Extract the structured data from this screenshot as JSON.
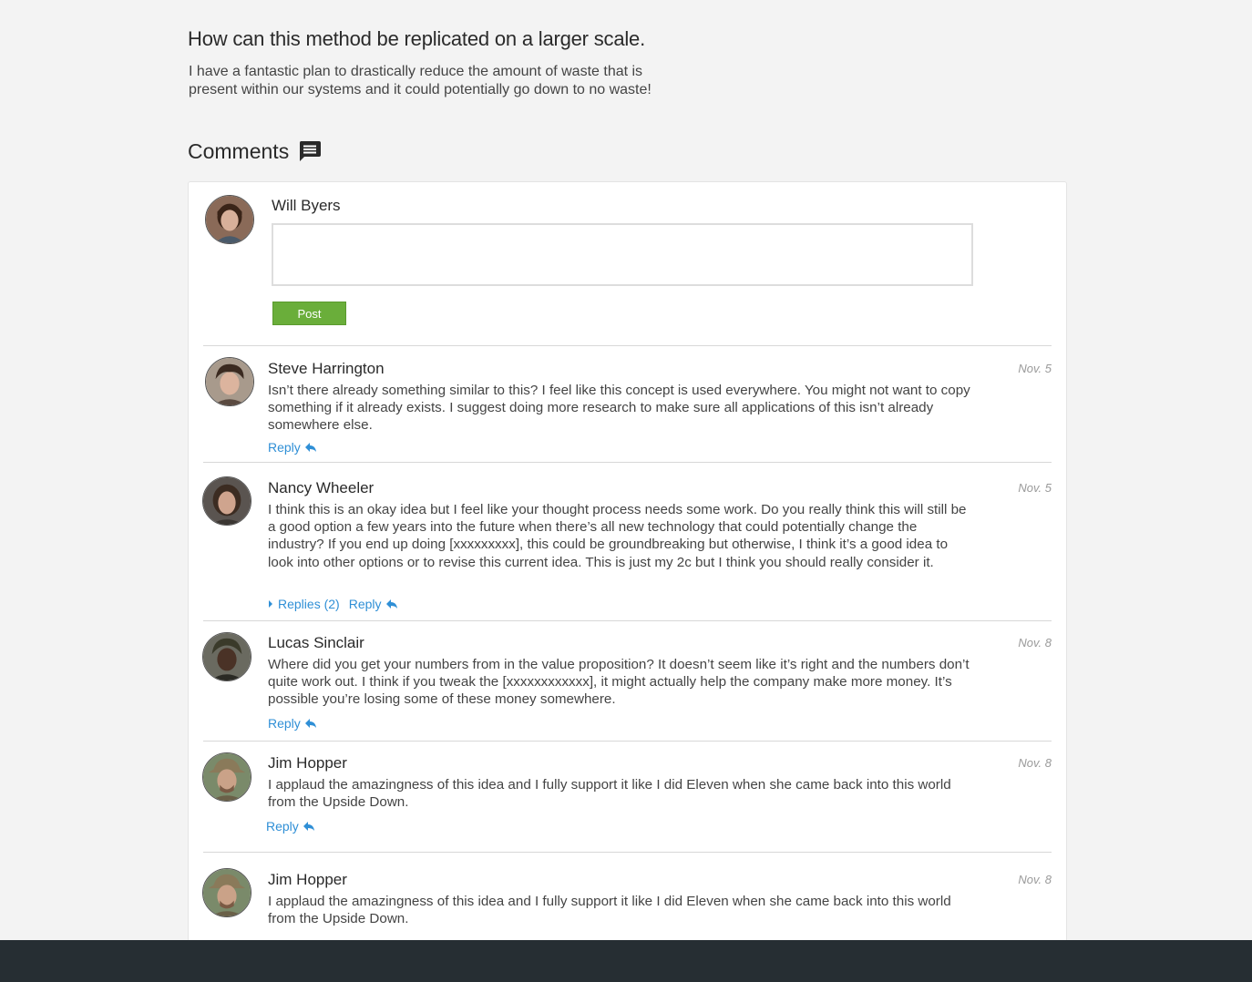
{
  "idea": {
    "title": "How can this method be replicated on a larger scale.",
    "description": "I have a fantastic plan to drastically reduce the amount of waste that is present within our systems and it could potentially go down to no waste!"
  },
  "comments_section": {
    "heading": "Comments",
    "icon": "comment-icon"
  },
  "composer": {
    "user_name": "Will Byers",
    "input_value": "",
    "post_label": "Post"
  },
  "comments": [
    {
      "author": "Steve Harrington",
      "date": "Nov. 5",
      "text": "Isn’t there already something similar to this? I feel like this concept is used everywhere. You might not want to copy something if it already exists. I suggest doing more research to make sure all applications of this isn’t already somewhere else.",
      "reply_label": "Reply"
    },
    {
      "author": "Nancy Wheeler",
      "date": "Nov. 5",
      "text": "I think this is an okay idea but I feel like your thought process needs some work. Do you really think this will still be a good option a few years into the future when there’s all new technology that could potentially change the industry? If you end up doing [xxxxxxxxx], this could be groundbreaking but otherwise, I think it’s a good idea to look into other options or to revise this current idea. This is just my 2c but I think you should really consider it.",
      "replies_label": "Replies (2)",
      "reply_label": "Reply"
    },
    {
      "author": "Lucas Sinclair",
      "date": "Nov. 8",
      "text": "Where did you get your numbers from in the value proposition? It doesn’t seem like it’s right and the numbers don’t quite work out. I think if you tweak the [xxxxxxxxxxxx], it might actually help the company make more money. It’s possible you’re losing some of these money somewhere.",
      "reply_label": "Reply"
    },
    {
      "author": "Jim Hopper",
      "date": "Nov. 8",
      "text": "I applaud the amazingness of this idea and I fully support it like I did Eleven when she came back into this world from the Upside Down.",
      "reply_label": "Reply"
    },
    {
      "author": "Jim Hopper",
      "date": "Nov. 8",
      "text": "I applaud the amazingness of this idea and I fully support it like I did Eleven when she came back into this world from the Upside Down."
    }
  ],
  "colors": {
    "page_bg": "#f3f3f3",
    "link": "#2f8fd6",
    "post_button": "#6aae3a",
    "footer": "#262e33"
  }
}
